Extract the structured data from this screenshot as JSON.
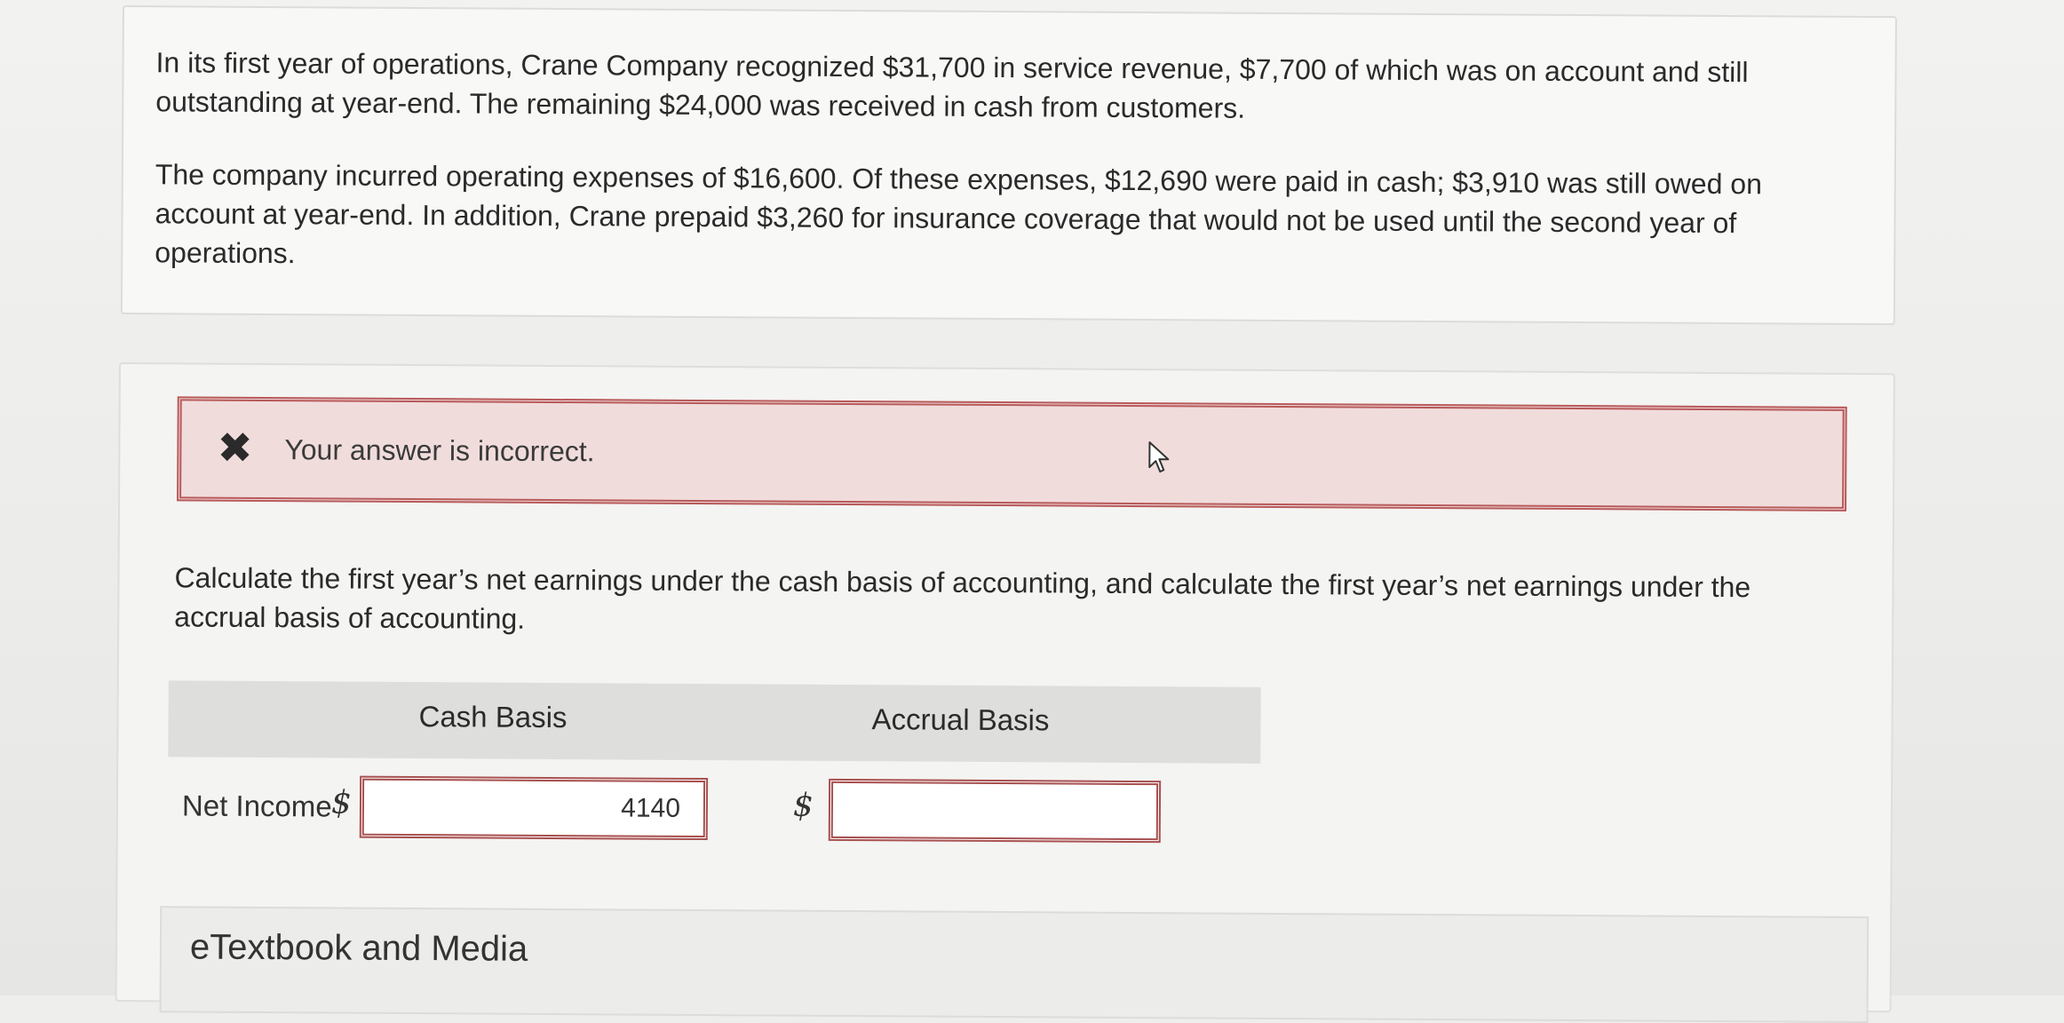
{
  "problem": {
    "paragraph1": "In its first year of operations, Crane Company recognized $31,700 in service revenue, $7,700 of which was on account and still outstanding at year-end. The remaining $24,000 was received in cash from customers.",
    "paragraph2": "The company incurred operating expenses of $16,600. Of these expenses, $12,690 were paid in cash; $3,910 was still owed on account at year-end. In addition, Crane prepaid $3,260 for insurance coverage that would not be used until the second year of operations."
  },
  "alert": {
    "icon": "close-x-icon",
    "message": "Your answer is incorrect.",
    "colors": {
      "background": "#f1dcdc",
      "border": "#b85a5a"
    }
  },
  "question": "Calculate the first year’s net earnings under the cash basis of accounting, and calculate the first year’s net earnings under the accrual basis of accounting.",
  "table": {
    "columns": [
      "Cash Basis",
      "Accrual Basis"
    ],
    "row_label": "Net Income",
    "currency": "$",
    "cash_value": "4140",
    "accrual_value": ""
  },
  "etextbook": {
    "label": "eTextbook and Media"
  }
}
